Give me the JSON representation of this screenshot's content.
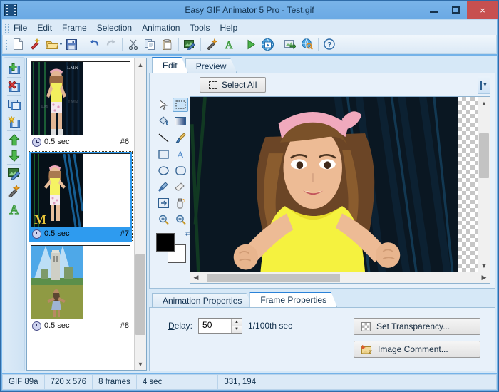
{
  "window": {
    "title": "Easy GIF Animator 5 Pro - Test.gif",
    "app_icon": "film-strip-icon",
    "minimize_label": "–",
    "maximize_label": "□",
    "close_label": "×",
    "accent_blue": "#2a82d8",
    "titlebar_blue": "#74b2e8",
    "close_red": "#c75050"
  },
  "menubar": {
    "items": [
      {
        "label": "File"
      },
      {
        "label": "Edit"
      },
      {
        "label": "Frame"
      },
      {
        "label": "Selection"
      },
      {
        "label": "Animation"
      },
      {
        "label": "Tools"
      },
      {
        "label": "Help"
      }
    ]
  },
  "toolbar": {
    "buttons": [
      {
        "name": "new-file-icon",
        "glyph": "📄"
      },
      {
        "name": "wizard-wand-icon",
        "glyph": "✨"
      },
      {
        "name": "open-folder-icon",
        "glyph": "📂",
        "has_dropdown": true
      },
      {
        "name": "save-icon",
        "glyph": "💾"
      },
      {
        "name": "undo-icon",
        "glyph": "↶"
      },
      {
        "name": "redo-icon",
        "glyph": "↷"
      },
      {
        "name": "cut-icon",
        "glyph": "✂"
      },
      {
        "name": "copy-icon",
        "glyph": "⧉"
      },
      {
        "name": "paste-icon",
        "glyph": "📋"
      },
      {
        "name": "edit-image-icon",
        "glyph": "🖼"
      },
      {
        "name": "magic-effects-icon",
        "glyph": "✨"
      },
      {
        "name": "add-text-icon",
        "glyph": "A"
      },
      {
        "name": "play-animation-icon",
        "glyph": "▶"
      },
      {
        "name": "publish-web-icon",
        "glyph": "🌐"
      },
      {
        "name": "export-image-icon",
        "glyph": "🖼"
      },
      {
        "name": "preview-browser-icon",
        "glyph": "🌎"
      },
      {
        "name": "help-icon",
        "glyph": "?"
      }
    ]
  },
  "frame_toolbar": {
    "buttons": [
      {
        "name": "add-frame-button",
        "title": "Add frame"
      },
      {
        "name": "delete-frame-button",
        "title": "Delete frame"
      },
      {
        "name": "duplicate-frame-button",
        "title": "Duplicate frame"
      },
      {
        "name": "frame-effect-button",
        "title": "Frame effect"
      },
      {
        "name": "move-frame-up-button",
        "title": "Move up"
      },
      {
        "name": "move-frame-down-button",
        "title": "Move down"
      },
      {
        "name": "edit-image-button",
        "title": "Edit image"
      },
      {
        "name": "magic-effect-button",
        "title": "Magic effect"
      },
      {
        "name": "add-text-button",
        "title": "Add text"
      }
    ]
  },
  "frames": [
    {
      "duration": "0.5 sec",
      "number": "#6",
      "selected": false,
      "image": "girl-yellow-top-dark"
    },
    {
      "duration": "0.5 sec",
      "number": "#7",
      "selected": true,
      "image": "girl-yellow-top-blue"
    },
    {
      "duration": "0.5 sec",
      "number": "#8",
      "selected": false,
      "image": "woman-field-tower"
    }
  ],
  "edit_panel": {
    "tabs": [
      {
        "label": "Edit",
        "active": true
      },
      {
        "label": "Preview",
        "active": false
      }
    ],
    "select_all_label": "Select All",
    "select_all_accesskey": "A",
    "overflow_icon": "chevron-down-icon",
    "tools": [
      {
        "name": "pointer-tool",
        "glyph": "➤"
      },
      {
        "name": "rectangle-select-tool",
        "glyph": "⬚",
        "active": true
      },
      {
        "name": "paint-bucket-tool",
        "glyph": "🪣"
      },
      {
        "name": "gradient-tool",
        "glyph": "▦"
      },
      {
        "name": "line-tool",
        "glyph": "╲"
      },
      {
        "name": "brush-tool",
        "glyph": "🖌"
      },
      {
        "name": "rectangle-tool",
        "glyph": "□"
      },
      {
        "name": "text-tool",
        "glyph": "A"
      },
      {
        "name": "ellipse-tool",
        "glyph": "◯"
      },
      {
        "name": "rounded-rect-tool",
        "glyph": "▢"
      },
      {
        "name": "eyedropper-tool",
        "glyph": "💊"
      },
      {
        "name": "eraser-tool",
        "glyph": "▱"
      },
      {
        "name": "transform-tool",
        "glyph": "⇥"
      },
      {
        "name": "spray-tool",
        "glyph": "🧴"
      },
      {
        "name": "zoom-in-tool",
        "glyph": "+"
      },
      {
        "name": "zoom-out-tool",
        "glyph": "−"
      }
    ],
    "foreground_color": "#000000",
    "background_color": "#ffffff",
    "swap_colors_icon": "swap-colors-icon"
  },
  "properties": {
    "tabs": [
      {
        "label": "Animation Properties",
        "active": false
      },
      {
        "label": "Frame Properties",
        "active": true
      }
    ],
    "delay_label": "Delay:",
    "delay_accesskey": "D",
    "delay_value": "50",
    "delay_units": "1/100th sec",
    "set_transparency_label": "Set Transparency...",
    "image_comment_label": "Image Comment..."
  },
  "statusbar": {
    "format": "GIF 89a",
    "dimensions": "720 x 576",
    "frame_count": "8 frames",
    "total_time": "4 sec",
    "spacer": "",
    "cursor_position": "331,  194"
  }
}
